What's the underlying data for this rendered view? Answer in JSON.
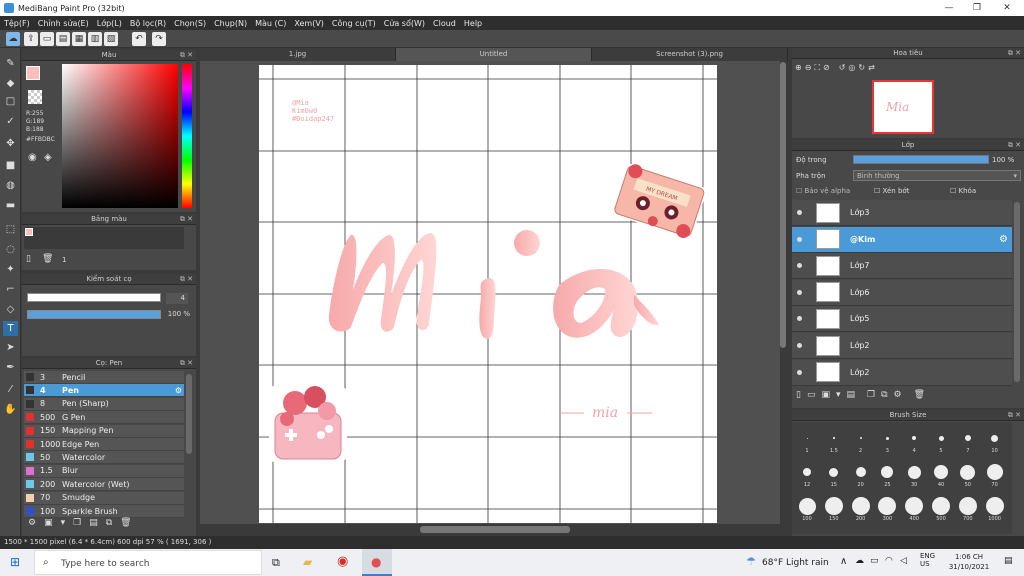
{
  "window": {
    "title": "MediBang Paint Pro (32bit)"
  },
  "menu": [
    "Tệp(F)",
    "Chỉnh sửa(E)",
    "Lớp(L)",
    "Bộ lọc(R)",
    "Chọn(S)",
    "Chụp(N)",
    "Màu (C)",
    "Xem(V)",
    "Công cụ(T)",
    "Cửa sổ(W)",
    "Cloud",
    "Help"
  ],
  "color_panel": {
    "title": "Màu",
    "r": "R:255",
    "g": "G:189",
    "b": "B:188",
    "hex": "#FFBDBC",
    "primary": "#ffbdbc"
  },
  "palette_panel": {
    "title": "Bảng màu",
    "count": "1"
  },
  "brush_control": {
    "title": "Kiểm soát cọ",
    "size": "4",
    "opacity": "100 %"
  },
  "brushes": {
    "title": "Cọ: Pen",
    "items": [
      {
        "size": "3",
        "name": "Pencil",
        "color": "#333333"
      },
      {
        "size": "4",
        "name": "Pen",
        "color": "#333333"
      },
      {
        "size": "8",
        "name": "Pen (Sharp)",
        "color": "#333333"
      },
      {
        "size": "500",
        "name": "G Pen",
        "color": "#e03030"
      },
      {
        "size": "150",
        "name": "Mapping Pen",
        "color": "#e03030"
      },
      {
        "size": "1000",
        "name": "Edge Pen",
        "color": "#e03030"
      },
      {
        "size": "50",
        "name": "Watercolor",
        "color": "#6cc8e8"
      },
      {
        "size": "1.5",
        "name": "Blur",
        "color": "#e070d0"
      },
      {
        "size": "200",
        "name": "Watercolor (Wet)",
        "color": "#6cc8e8"
      },
      {
        "size": "70",
        "name": "Smudge",
        "color": "#f0d0b0"
      },
      {
        "size": "100",
        "name": "Sparkle Brush",
        "color": "#3050d0"
      }
    ]
  },
  "tabs": [
    "1.jpg",
    "Untitled",
    "Screenshot (3).png"
  ],
  "canvas": {
    "small_text": [
      "@Mia",
      "Kim0w0",
      "#Đoidap247"
    ],
    "main_text": "Mia",
    "sub_text": "mia",
    "sticker_text": "MY DREAM"
  },
  "navigator": {
    "title": "Hoa tiêu"
  },
  "layers": {
    "title": "Lớp",
    "opacity_label": "Độ trong",
    "opacity_value": "100 %",
    "opacity_fraction": 1.0,
    "blend_label": "Pha trộn",
    "blend_value": "Bình thường",
    "protect_alpha": "Bảo vệ alpha",
    "clipping": "Xén bớt",
    "lock": "Khóa",
    "items": [
      "Lớp3",
      "@Kim",
      "Lớp7",
      "Lớp6",
      "Lớp5",
      "Lớp2",
      "Lớp2"
    ],
    "selected_index": 1
  },
  "brush_size": {
    "title": "Brush Size",
    "sizes": [
      "1",
      "1.5",
      "2",
      "3",
      "4",
      "5",
      "7",
      "10",
      "12",
      "15",
      "20",
      "25",
      "30",
      "40",
      "50",
      "70",
      "100",
      "150",
      "200",
      "300",
      "400",
      "500",
      "700",
      "1000"
    ]
  },
  "status": "1500 * 1500 pixel  (6.4 * 6.4cm)  600 dpi  57 %  ( 1691, 306 )",
  "taskbar": {
    "search": "Type here to search",
    "weather": "68°F  Light rain",
    "lang1": "ENG",
    "lang2": "US",
    "time": "1:06 CH",
    "date": "31/10/2021"
  }
}
